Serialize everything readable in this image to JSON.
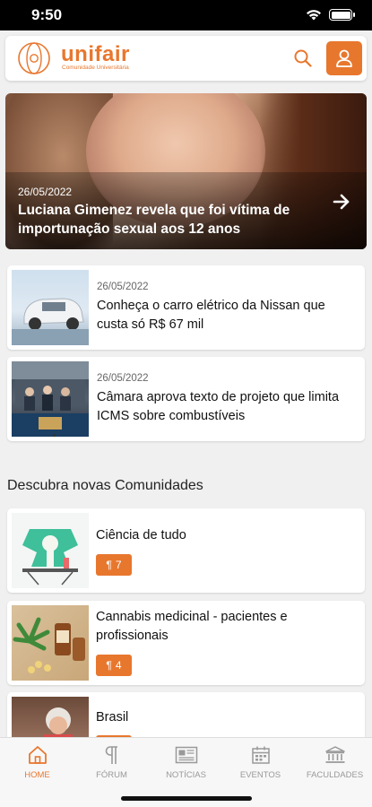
{
  "status": {
    "time": "9:50"
  },
  "header": {
    "brand": "unifair",
    "tagline": "Comunidade Universitária"
  },
  "hero": {
    "date": "26/05/2022",
    "title": "Luciana Gimenez revela que foi vítima de importunação sexual aos 12 anos"
  },
  "news": [
    {
      "date": "26/05/2022",
      "title": "Conheça o carro elétrico da Nissan que custa só R$ 67 mil"
    },
    {
      "date": "26/05/2022",
      "title": "Câmara aprova texto de projeto que limita ICMS sobre combustíveis"
    }
  ],
  "communities": {
    "section_title": "Descubra novas Comunidades",
    "items": [
      {
        "name": "Ciência de tudo",
        "count": "7"
      },
      {
        "name": "Cannabis medicinal - pacientes e profissionais",
        "count": "4"
      },
      {
        "name": "Brasil",
        "count": ""
      }
    ]
  },
  "tabs": [
    {
      "label": "HOME",
      "icon": "home-icon",
      "active": true
    },
    {
      "label": "FÓRUM",
      "icon": "pilcrow-icon",
      "active": false
    },
    {
      "label": "NOTÍCIAS",
      "icon": "newspaper-icon",
      "active": false
    },
    {
      "label": "EVENTOS",
      "icon": "calendar-icon",
      "active": false
    },
    {
      "label": "FACULDADES",
      "icon": "institution-icon",
      "active": false
    }
  ],
  "colors": {
    "accent": "#e8772e"
  }
}
